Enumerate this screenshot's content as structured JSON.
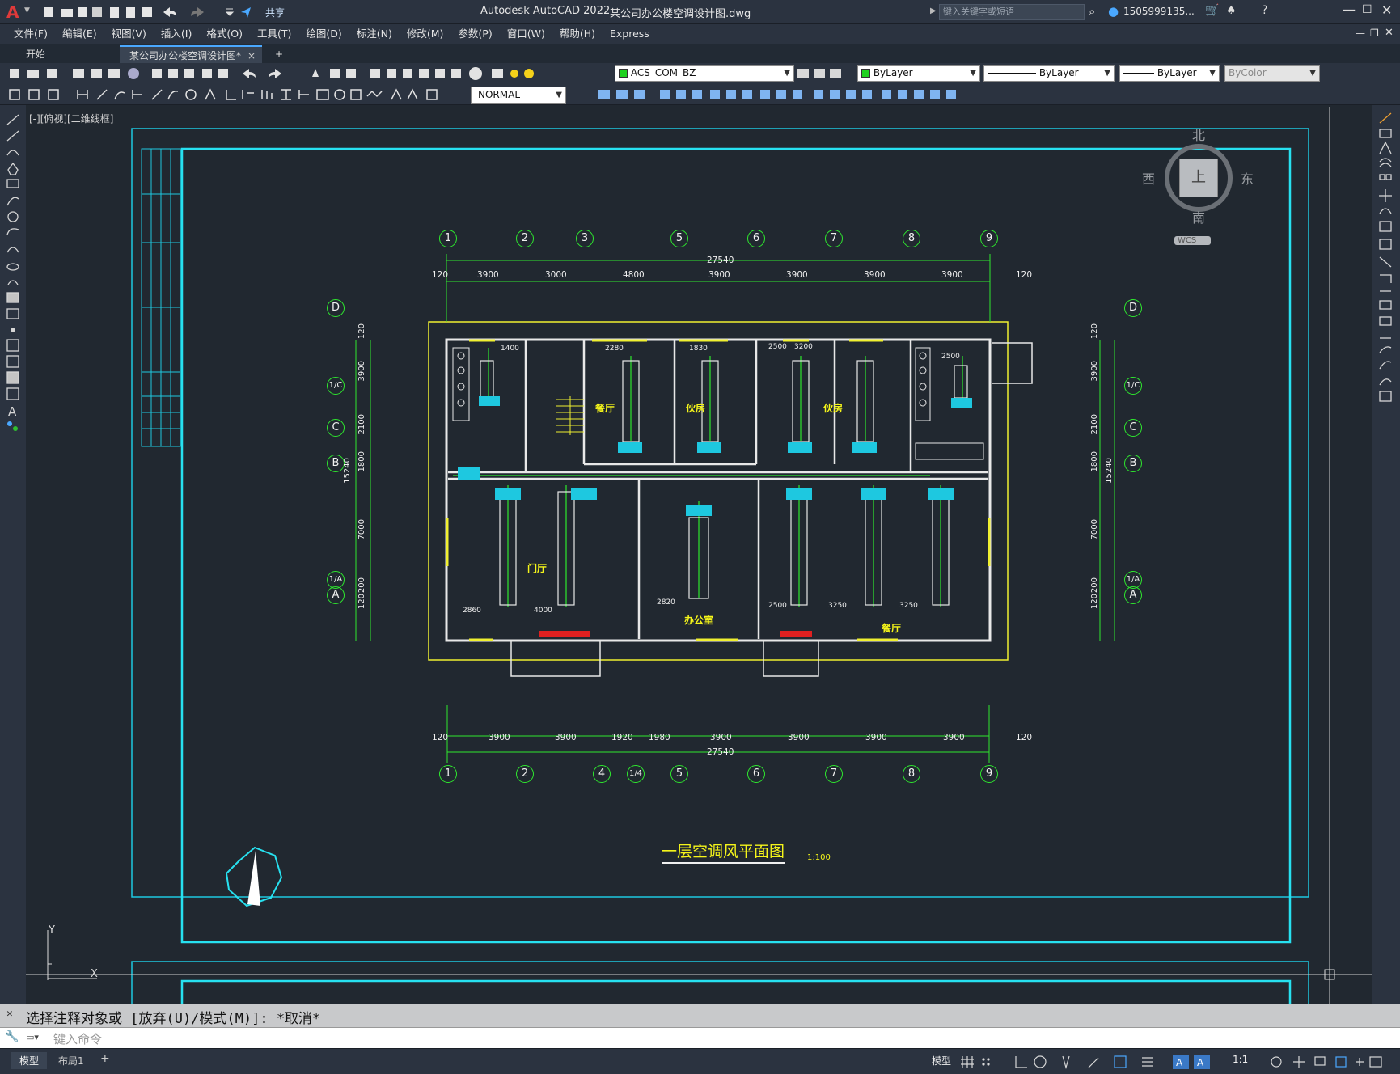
{
  "app": {
    "title": "Autodesk AutoCAD 2022",
    "file": "某公司办公楼空调设计图.dwg",
    "share_label": "共享",
    "search_placeholder": "键入关键字或短语",
    "user": "1505999135..."
  },
  "menu": [
    "文件(F)",
    "编辑(E)",
    "视图(V)",
    "插入(I)",
    "格式(O)",
    "工具(T)",
    "绘图(D)",
    "标注(N)",
    "修改(M)",
    "参数(P)",
    "窗口(W)",
    "帮助(H)",
    "Express"
  ],
  "tabs": {
    "start": "开始",
    "drawing": "某公司办公楼空调设计图*",
    "add": "+"
  },
  "toolbar": {
    "layer": "ACS_COM_BZ",
    "color": "ByLayer",
    "linetype": "ByLayer",
    "lineweight": "ByLayer",
    "plotstyle": "ByColor",
    "dimstyle": "NORMAL"
  },
  "viewport_label": "[-][俯视][二维线框]",
  "viewcube": {
    "north": "北",
    "south": "南",
    "east": "东",
    "west": "西",
    "top": "上",
    "wcs": "WCS"
  },
  "drawing": {
    "title": "一层空调风平面图",
    "scale": "1:100",
    "top_axes": [
      "1",
      "2",
      "3",
      "5",
      "6",
      "7",
      "8",
      "9"
    ],
    "top_dims": [
      "120",
      "3900",
      "3000",
      "4800",
      "3900",
      "3900",
      "3900",
      "3900",
      "120"
    ],
    "top_total": "27540",
    "bottom_axes": [
      "1",
      "2",
      "4",
      "1/4",
      "5",
      "6",
      "7",
      "8",
      "9"
    ],
    "bottom_dims": [
      "120",
      "3900",
      "3900",
      "1920",
      "1980",
      "3900",
      "3900",
      "3900",
      "3900",
      "120"
    ],
    "bottom_total": "27540",
    "row_axes": [
      "D",
      "1/C",
      "C",
      "B",
      "1/A",
      "A"
    ],
    "side_dims": [
      "120",
      "3900",
      "2100",
      "1800",
      "7000",
      "200",
      "120"
    ],
    "side_total": "15240",
    "rooms": [
      "餐厅",
      "伙房",
      "伙房",
      "门厅",
      "办公室",
      "餐厅"
    ],
    "room_dims": [
      "1400",
      "2280",
      "1830",
      "2500",
      "3200",
      "2500",
      "2860",
      "4000",
      "2820",
      "2500",
      "3250",
      "3250"
    ]
  },
  "command": {
    "history": "选择注释对象或 [放弃(U)/模式(M)]: *取消*",
    "placeholder": "键入命令"
  },
  "status": {
    "model_tab": "模型",
    "layout_tab": "布局1",
    "model_label": "模型",
    "scale": "1:1"
  }
}
